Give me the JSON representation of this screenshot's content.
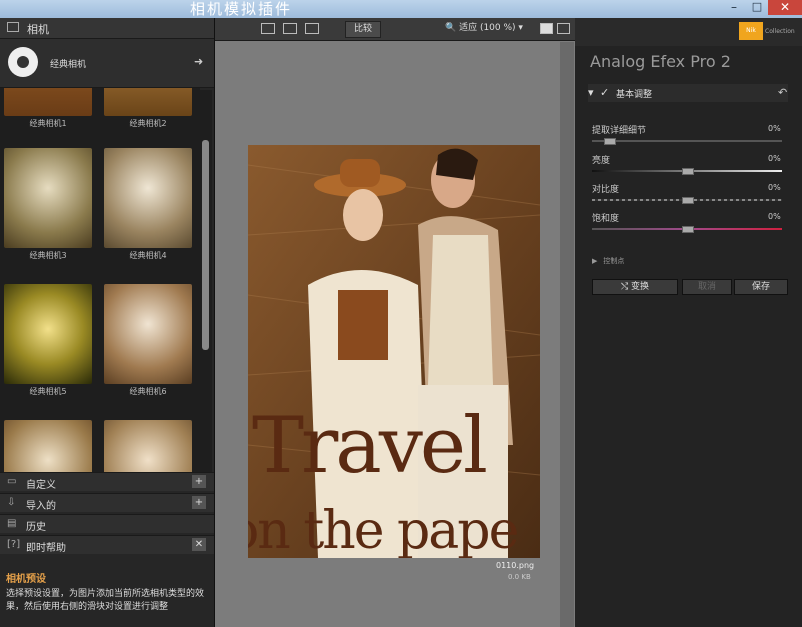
{
  "window": {
    "title": "相机模拟插件"
  },
  "left": {
    "header": "相机",
    "camera_name": "经典相机",
    "thumbs": [
      "经典相机1",
      "经典相机2",
      "经典相机3",
      "经典相机4",
      "经典相机5",
      "经典相机6"
    ],
    "accordion": [
      {
        "label": "自定义",
        "btn": "+"
      },
      {
        "label": "导入的",
        "btn": "+"
      },
      {
        "label": "历史",
        "btn": ""
      },
      {
        "label": "即时帮助",
        "btn": "✕"
      }
    ],
    "preset_title": "相机预设",
    "preset_desc": "选择预设设置，为图片添加当前所选相机类型的效果，然后使用右侧的滑块对设置进行调整"
  },
  "toolbar": {
    "compare_label": "比较",
    "zoom_label": "适应 (100 %)"
  },
  "image": {
    "filename": "0110.png",
    "filesize": "0.0 KB",
    "caption_line1": "Travel",
    "caption_line2": "on the pape"
  },
  "right": {
    "app_name": "Analog Efex Pro 2",
    "brand": "Nik",
    "brand_sub": "Collection",
    "section_title": "基本调整",
    "sliders": [
      {
        "label": "提取详细细节",
        "value": "0%",
        "level": 0.06
      },
      {
        "label": "亮度",
        "value": "0%",
        "level": 0.5
      },
      {
        "label": "对比度",
        "value": "0%",
        "level": 0.5
      },
      {
        "label": "饱和度",
        "value": "0%",
        "level": 0.5
      }
    ],
    "control_points": "控制点",
    "buttons": {
      "shuffle": "变换",
      "undo": "取消",
      "save": "保存"
    }
  },
  "colors": {
    "accent": "#e6a14a",
    "titlebar": "#9dbbdb",
    "close": "#c9463c"
  }
}
